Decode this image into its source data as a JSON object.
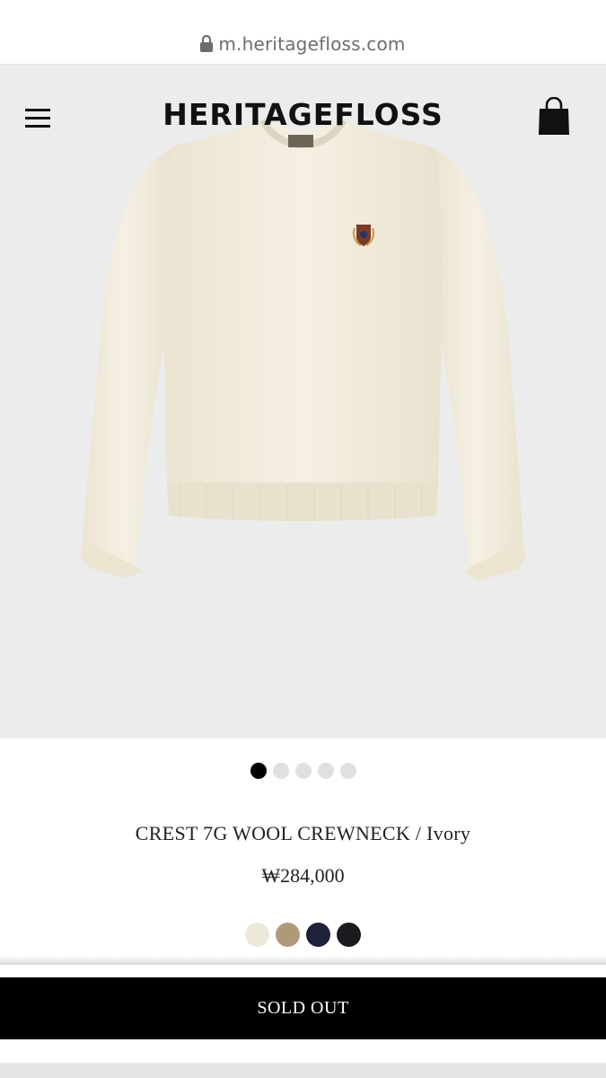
{
  "browser": {
    "url": "m.heritagefloss.com",
    "icons": {
      "lock": "lock-icon"
    }
  },
  "header": {
    "logo": "HERITAGEFLOSS",
    "icons": {
      "menu": "hamburger-menu-icon",
      "cart": "shopping-bag-icon"
    }
  },
  "gallery": {
    "image": "ivory crewneck sweater product photo",
    "total_images": 5,
    "active_index": 0,
    "colors": {
      "background": "#ececec",
      "sweater": "#f2ecdc"
    }
  },
  "product": {
    "name": "CREST 7G WOOL CREWNECK / Ivory",
    "price": "₩284,000"
  },
  "swatches": [
    {
      "color_name": "ivory",
      "hex": "#ece8da"
    },
    {
      "color_name": "beige",
      "hex": "#ae9a7a"
    },
    {
      "color_name": "navy",
      "hex": "#1e2239"
    },
    {
      "color_name": "black",
      "hex": "#1b1c20"
    }
  ],
  "action": {
    "sold_out_label": "SOLD OUT"
  },
  "colors": {
    "accent": "#000000",
    "text": "#222222"
  }
}
